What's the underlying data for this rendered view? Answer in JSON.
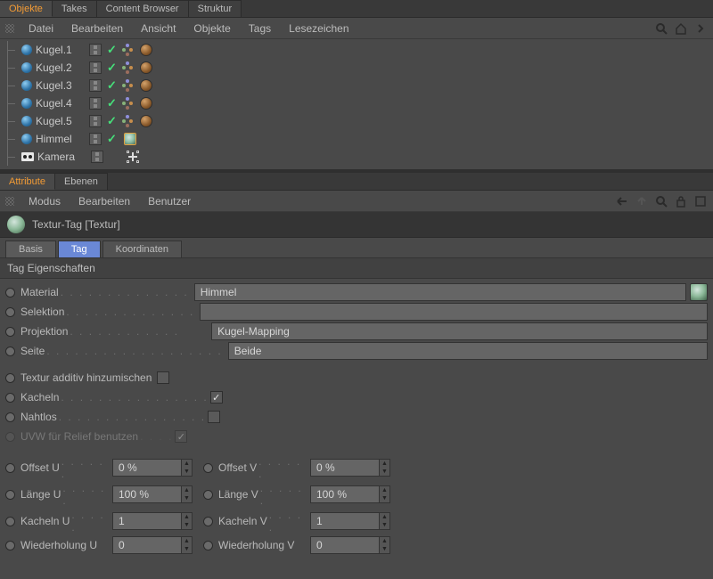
{
  "top_tabs": [
    "Objekte",
    "Takes",
    "Content Browser",
    "Struktur"
  ],
  "obj_menu": [
    "Datei",
    "Bearbeiten",
    "Ansicht",
    "Objekte",
    "Tags",
    "Lesezeichen"
  ],
  "objects": {
    "kugel": [
      "Kugel.1",
      "Kugel.2",
      "Kugel.3",
      "Kugel.4",
      "Kugel.5"
    ],
    "himmel": "Himmel",
    "kamera": "Kamera"
  },
  "attr_tabs": [
    "Attribute",
    "Ebenen"
  ],
  "attr_menu": [
    "Modus",
    "Bearbeiten",
    "Benutzer"
  ],
  "attr_title": "Textur-Tag [Textur]",
  "sub_tabs": [
    "Basis",
    "Tag",
    "Koordinaten"
  ],
  "group_title": "Tag Eigenschaften",
  "fields": {
    "material_label": "Material",
    "material_value": "Himmel",
    "selektion_label": "Selektion",
    "selektion_value": "",
    "projektion_label": "Projektion",
    "projektion_value": "Kugel-Mapping",
    "seite_label": "Seite",
    "seite_value": "Beide",
    "additiv_label": "Textur additiv hinzumischen",
    "kacheln_label": "Kacheln",
    "nahtlos_label": "Nahtlos",
    "uvw_label": "UVW für Relief benutzen",
    "offset_u_label": "Offset U",
    "offset_u_value": "0 %",
    "offset_v_label": "Offset V",
    "offset_v_value": "0 %",
    "laenge_u_label": "Länge U",
    "laenge_u_value": "100 %",
    "laenge_v_label": "Länge V",
    "laenge_v_value": "100 %",
    "kacheln_u_label": "Kacheln U",
    "kacheln_u_value": "1",
    "kacheln_v_label": "Kacheln V",
    "kacheln_v_value": "1",
    "wdh_u_label": "Wiederholung U",
    "wdh_u_value": "0",
    "wdh_v_label": "Wiederholung V",
    "wdh_v_value": "0"
  },
  "checks": {
    "additiv": false,
    "kacheln": true,
    "nahtlos": false,
    "uvw": true
  }
}
